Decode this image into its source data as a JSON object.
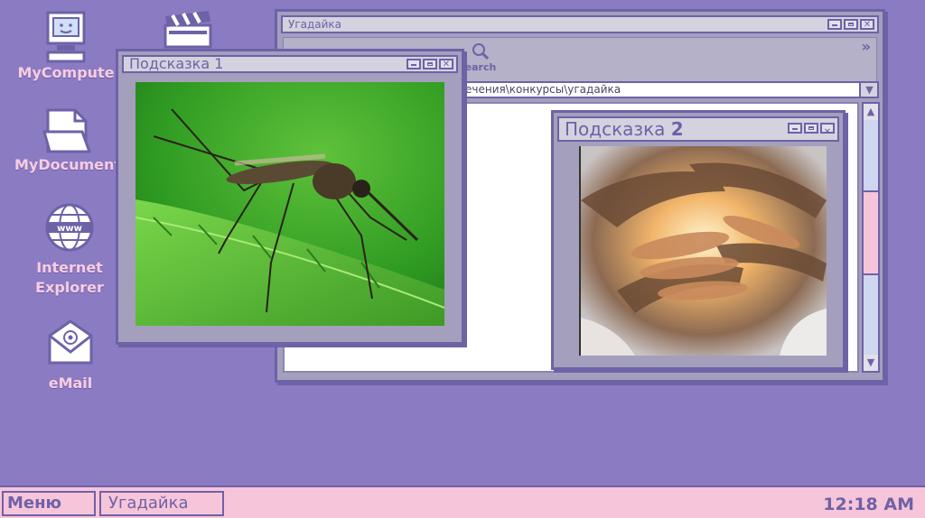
{
  "desktop": {
    "icons": [
      {
        "label": "MyCompute",
        "icon": "computer-icon"
      },
      {
        "label": "MyDocument",
        "icon": "document-icon"
      },
      {
        "label": "Internet Explorer",
        "icon": "globe-icon"
      },
      {
        "label": "eMail",
        "icon": "email-icon"
      },
      {
        "label": "",
        "icon": "clapperboard-icon"
      }
    ]
  },
  "main_window": {
    "title": "Угадайка",
    "toolbar": {
      "search_label": "earch"
    },
    "address": "ечения\\конкурсы\\угадайка"
  },
  "hint1": {
    "title_word": "Подсказка",
    "title_num": "1",
    "image": "mosquito-on-leaf"
  },
  "hint2": {
    "title_word": "Подсказка",
    "title_num": "2",
    "image": "glowing-hands"
  },
  "taskbar": {
    "menu_label": "Меню",
    "task_label": "Угадайка",
    "clock": "12:18 AM"
  },
  "colors": {
    "desktop": "#8b7bc3",
    "accent": "#6e62a7",
    "taskbar": "#f7c5da",
    "label": "#f8cde0"
  }
}
